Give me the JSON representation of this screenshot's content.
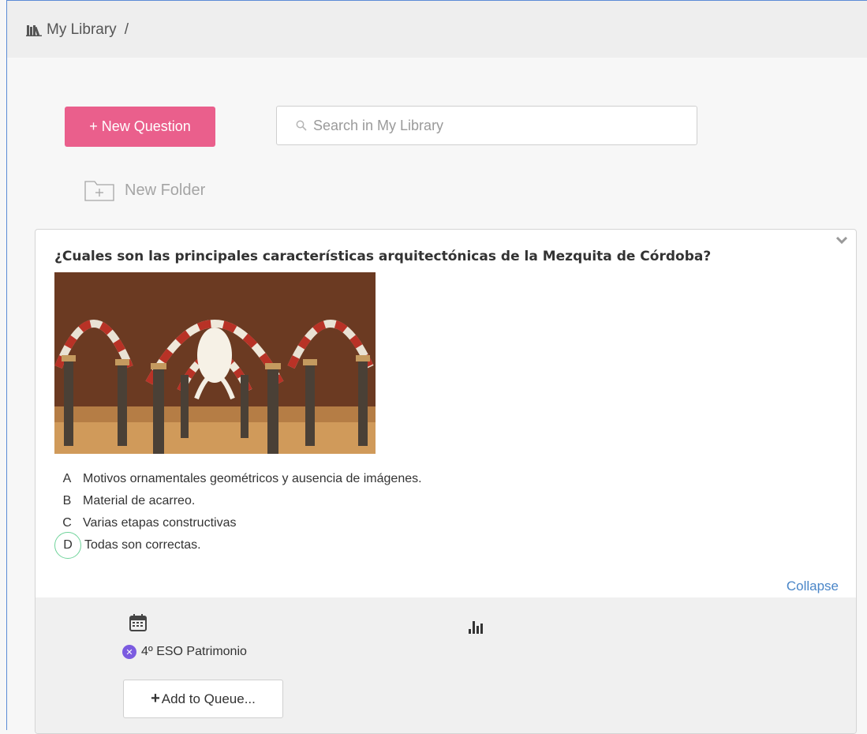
{
  "header": {
    "breadcrumb_root": "My Library",
    "breadcrumb_separator": "/",
    "library_icon": "books-icon"
  },
  "toolbar": {
    "new_question_label": "+ New Question",
    "search_placeholder": "Search in My Library",
    "search_value": "",
    "new_folder_label": "New Folder",
    "accent_color": "#ea5f8c"
  },
  "question": {
    "title": "¿Cuales son las principales características arquitectónicas de la Mezquita de Córdoba?",
    "image": "mosque-interior-arches-image",
    "answers": [
      {
        "letter": "A",
        "text": "Motivos ornamentales geométricos y ausencia de imágenes.",
        "correct": false
      },
      {
        "letter": "B",
        "text": "Material de acarreo.",
        "correct": false
      },
      {
        "letter": "C",
        "text": "Varias etapas constructivas",
        "correct": false
      },
      {
        "letter": "D",
        "text": "Todas son correctas.",
        "correct": true
      }
    ],
    "collapse_label": "Collapse",
    "correct_color": "#6fd39a"
  },
  "footer": {
    "calendar_icon": "calendar-icon",
    "reports_icon": "bar-chart-icon",
    "class_tag": "4º ESO Patrimonio",
    "add_to_queue_label": "Add to Queue...",
    "tag_color": "#7b5be0"
  }
}
